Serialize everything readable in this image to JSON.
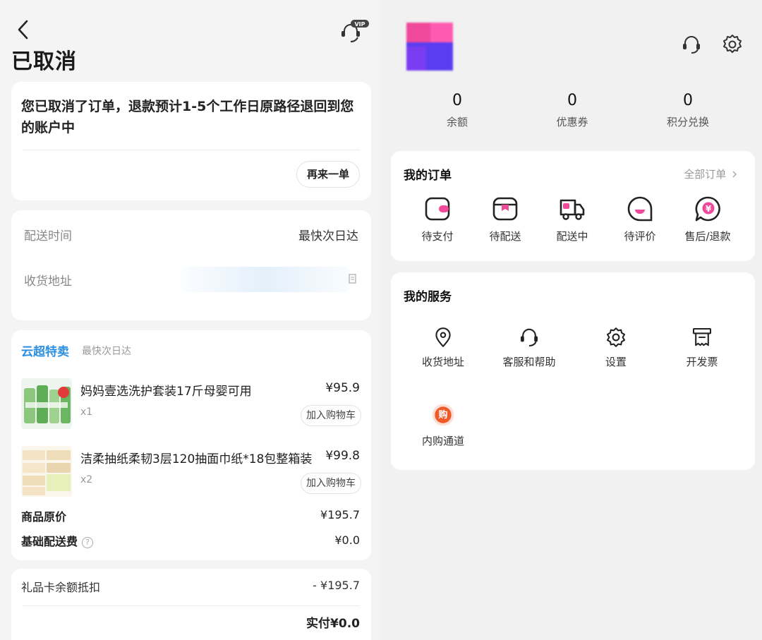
{
  "left": {
    "title": "已取消",
    "cancel_message": "您已取消了订单，退款预计1-5个工作日原路径退回到您的账户中",
    "reorder_label": "再来一单",
    "delivery_time_label": "配送时间",
    "delivery_time_value": "最快次日达",
    "address_label": "收货地址",
    "store_name": "云超特卖",
    "store_delivery": "最快次日达",
    "products": [
      {
        "name": "妈妈壹选洗护套装17斤母婴可用",
        "price": "¥95.9",
        "qty": "x1",
        "add_cart": "加入购物车"
      },
      {
        "name": "洁柔抽纸柔韧3层120抽面巾纸*18包整箱装",
        "price": "¥99.8",
        "qty": "x2",
        "add_cart": "加入购物车"
      }
    ],
    "original_price_label": "商品原价",
    "original_price_value": "¥195.7",
    "shipping_label": "基础配送费",
    "shipping_value": "¥0.0",
    "giftcard_label": "礼品卡余额抵扣",
    "giftcard_value": "- ¥195.7",
    "paid_label": "实付¥0.0"
  },
  "right": {
    "stats": [
      {
        "value": "0",
        "label": "余额"
      },
      {
        "value": "0",
        "label": "优惠券"
      },
      {
        "value": "0",
        "label": "积分兑换"
      }
    ],
    "orders_title": "我的订单",
    "all_orders": "全部订单",
    "order_tiles": [
      {
        "label": "待支付",
        "icon": "wallet-icon"
      },
      {
        "label": "待配送",
        "icon": "package-icon"
      },
      {
        "label": "配送中",
        "icon": "truck-icon"
      },
      {
        "label": "待评价",
        "icon": "review-icon"
      },
      {
        "label": "售后/退款",
        "icon": "refund-icon"
      }
    ],
    "services_title": "我的服务",
    "service_tiles": [
      {
        "label": "收货地址",
        "icon": "location-icon"
      },
      {
        "label": "客服和帮助",
        "icon": "headset-icon"
      },
      {
        "label": "设置",
        "icon": "gear-icon"
      },
      {
        "label": "开发票",
        "icon": "invoice-icon"
      },
      {
        "label": "内购通道",
        "icon": "purchase-badge-icon",
        "badge": "购"
      }
    ]
  },
  "colors": {
    "accent_pink": "#f0489a",
    "brand_blue": "#2b8fe0",
    "purchase_orange": "#f05a28"
  }
}
